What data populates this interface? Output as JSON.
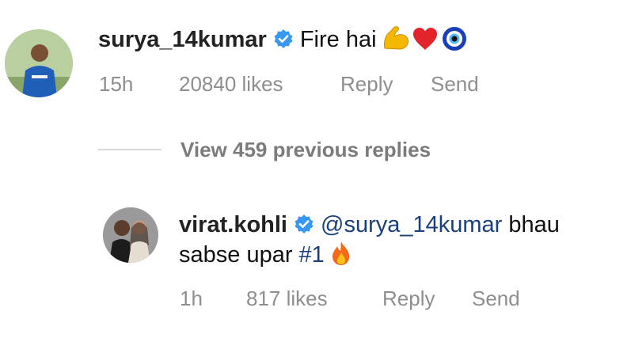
{
  "comment": {
    "username": "surya_14kumar",
    "text": "Fire hai",
    "emojis": [
      "flexed-biceps-icon",
      "red-heart-icon",
      "nazar-amulet-icon"
    ],
    "time": "15h",
    "likes": "20840 likes",
    "reply_label": "Reply",
    "send_label": "Send"
  },
  "view_replies": "View 459 previous replies",
  "reply": {
    "username": "virat.kohli",
    "mention": "@surya_14kumar",
    "text_after_mention": " bhau",
    "text_line2": "sabse upar ",
    "hashtag": "#1",
    "emoji": "fire-icon",
    "time": "1h",
    "likes": "817 likes",
    "reply_label": "Reply",
    "send_label": "Send"
  },
  "colors": {
    "verified": "#3897f0",
    "mention": "#1a3f7a",
    "meta": "#8e8e8e"
  }
}
